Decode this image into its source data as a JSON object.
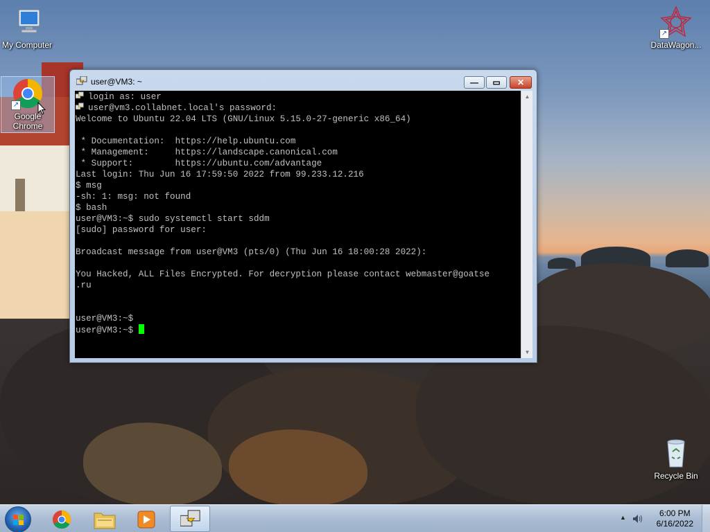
{
  "desktop": {
    "icons": [
      {
        "label": "My Computer",
        "icon": "computer-icon"
      },
      {
        "label": "Google\nChrome",
        "icon": "chrome-icon"
      },
      {
        "label": "DataWagon...",
        "icon": "datawagon-icon"
      },
      {
        "label": "Recycle Bin",
        "icon": "recycle-bin-icon"
      }
    ]
  },
  "putty": {
    "title": "user@VM3: ~",
    "icon": "putty-icon",
    "terminal": {
      "lines": [
        {
          "text": "login as: user",
          "icon": true
        },
        {
          "text": "user@vm3.collabnet.local's password:",
          "icon": true
        },
        {
          "text": "Welcome to Ubuntu 22.04 LTS (GNU/Linux 5.15.0-27-generic x86_64)"
        },
        {
          "text": ""
        },
        {
          "text": " * Documentation:  https://help.ubuntu.com"
        },
        {
          "text": " * Management:     https://landscape.canonical.com"
        },
        {
          "text": " * Support:        https://ubuntu.com/advantage"
        },
        {
          "text": "Last login: Thu Jun 16 17:59:50 2022 from 99.233.12.216"
        },
        {
          "text": "$ msg"
        },
        {
          "text": "-sh: 1: msg: not found"
        },
        {
          "text": "$ bash"
        },
        {
          "text": "user@VM3:~$ sudo systemctl start sddm"
        },
        {
          "text": "[sudo] password for user:"
        },
        {
          "text": ""
        },
        {
          "text": "Broadcast message from user@VM3 (pts/0) (Thu Jun 16 18:00:28 2022):"
        },
        {
          "text": ""
        },
        {
          "text": "You Hacked, ALL Files Encrypted. For decryption please contact webmaster@goatse"
        },
        {
          "text": ".ru"
        },
        {
          "text": ""
        },
        {
          "text": ""
        },
        {
          "text": "user@VM3:~$"
        },
        {
          "text": "user@VM3:~$ ",
          "cursor": true
        }
      ],
      "cursor_color": "#00ff00"
    }
  },
  "taskbar": {
    "start_icon": "windows-start-orb",
    "pinned": [
      {
        "name": "chrome-taskbar-button",
        "icon": "chrome-icon"
      },
      {
        "name": "explorer-taskbar-button",
        "icon": "folder-icon"
      },
      {
        "name": "media-player-taskbar-button",
        "icon": "media-player-icon"
      },
      {
        "name": "putty-taskbar-button",
        "icon": "putty-icon",
        "active": true
      }
    ],
    "tray": {
      "show_hidden_icon": "chevron-up-icon",
      "volume_icon": "speaker-icon",
      "time": "6:00 PM",
      "date": "6/16/2022"
    }
  }
}
